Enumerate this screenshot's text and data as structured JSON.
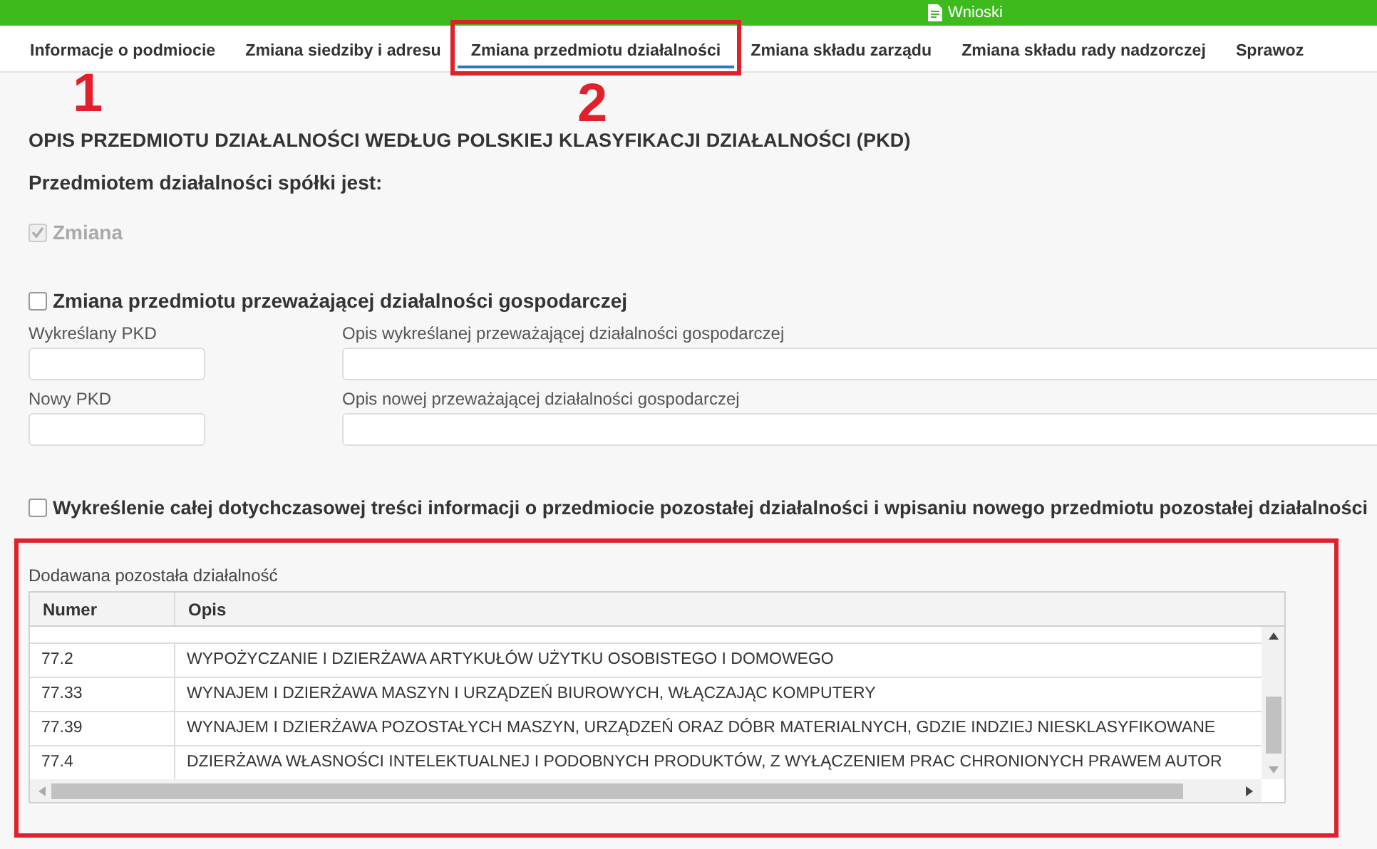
{
  "top_bar": {
    "title": "Wnioski"
  },
  "tabs": [
    {
      "label": "Informacje o podmiocie",
      "selected": false
    },
    {
      "label": "Zmiana siedziby i adresu",
      "selected": false
    },
    {
      "label": "Zmiana przedmiotu działalności",
      "selected": true
    },
    {
      "label": "Zmiana składu zarządu",
      "selected": false
    },
    {
      "label": "Zmiana składu rady nadzorczej",
      "selected": false
    },
    {
      "label": "Sprawoz",
      "selected": false
    }
  ],
  "section_title": "OPIS PRZEDMIOTU DZIAŁALNOŚCI WEDŁUG POLSKIEJ KLASYFIKACJI DZIAŁALNOŚCI (PKD)",
  "subtitle": "Przedmiotem działalności spółki jest:",
  "change_checkbox": {
    "label": "Zmiana",
    "checked": true,
    "disabled": true
  },
  "main_activity_checkbox": {
    "label": "Zmiana przedmiotu przeważającej działalności gospodarczej",
    "checked": false,
    "disabled": false
  },
  "fields": [
    {
      "code_label": "Wykreślany PKD",
      "description_label": "Opis wykreślanej przeważającej działalności gospodarczej"
    },
    {
      "code_label": "Nowy PKD",
      "description_label": "Opis nowej przeważającej działalności gospodarczej"
    }
  ],
  "other_activity_checkbox": {
    "label": "Wykreślenie całej dotychczasowej treści informacji o przedmiocie pozostałej działalności i wpisaniu nowego przedmiotu pozostałej działalności",
    "checked": false,
    "disabled": false
  },
  "table": {
    "caption": "Dodawana pozostała działalność",
    "columns": [
      "Numer",
      "Opis"
    ],
    "rows": [
      {
        "numer": "77.2",
        "opis": "WYPOŻYCZANIE I DZIERŻAWA ARTYKUŁÓW UŻYTKU OSOBISTEGO I DOMOWEGO"
      },
      {
        "numer": "77.33",
        "opis": "WYNAJEM I DZIERŻAWA MASZYN I URZĄDZEŃ BIUROWYCH, WŁĄCZAJĄC KOMPUTERY"
      },
      {
        "numer": "77.39",
        "opis": "WYNAJEM I DZIERŻAWA POZOSTAŁYCH MASZYN, URZĄDZEŃ ORAZ DÓBR MATERIALNYCH, GDZIE INDZIEJ NIESKLASYFIKOWANE"
      },
      {
        "numer": "77.4",
        "opis": "DZIERŻAWA WŁASNOŚCI INTELEKTUALNEJ I PODOBNYCH PRODUKTÓW, Z WYŁĄCZENIEM PRAC CHRONIONYCH PRAWEM AUTOR"
      }
    ]
  },
  "annotations": [
    {
      "kind": "number",
      "text": "1"
    },
    {
      "kind": "number",
      "text": "2"
    },
    {
      "kind": "frame"
    },
    {
      "kind": "frame"
    }
  ]
}
